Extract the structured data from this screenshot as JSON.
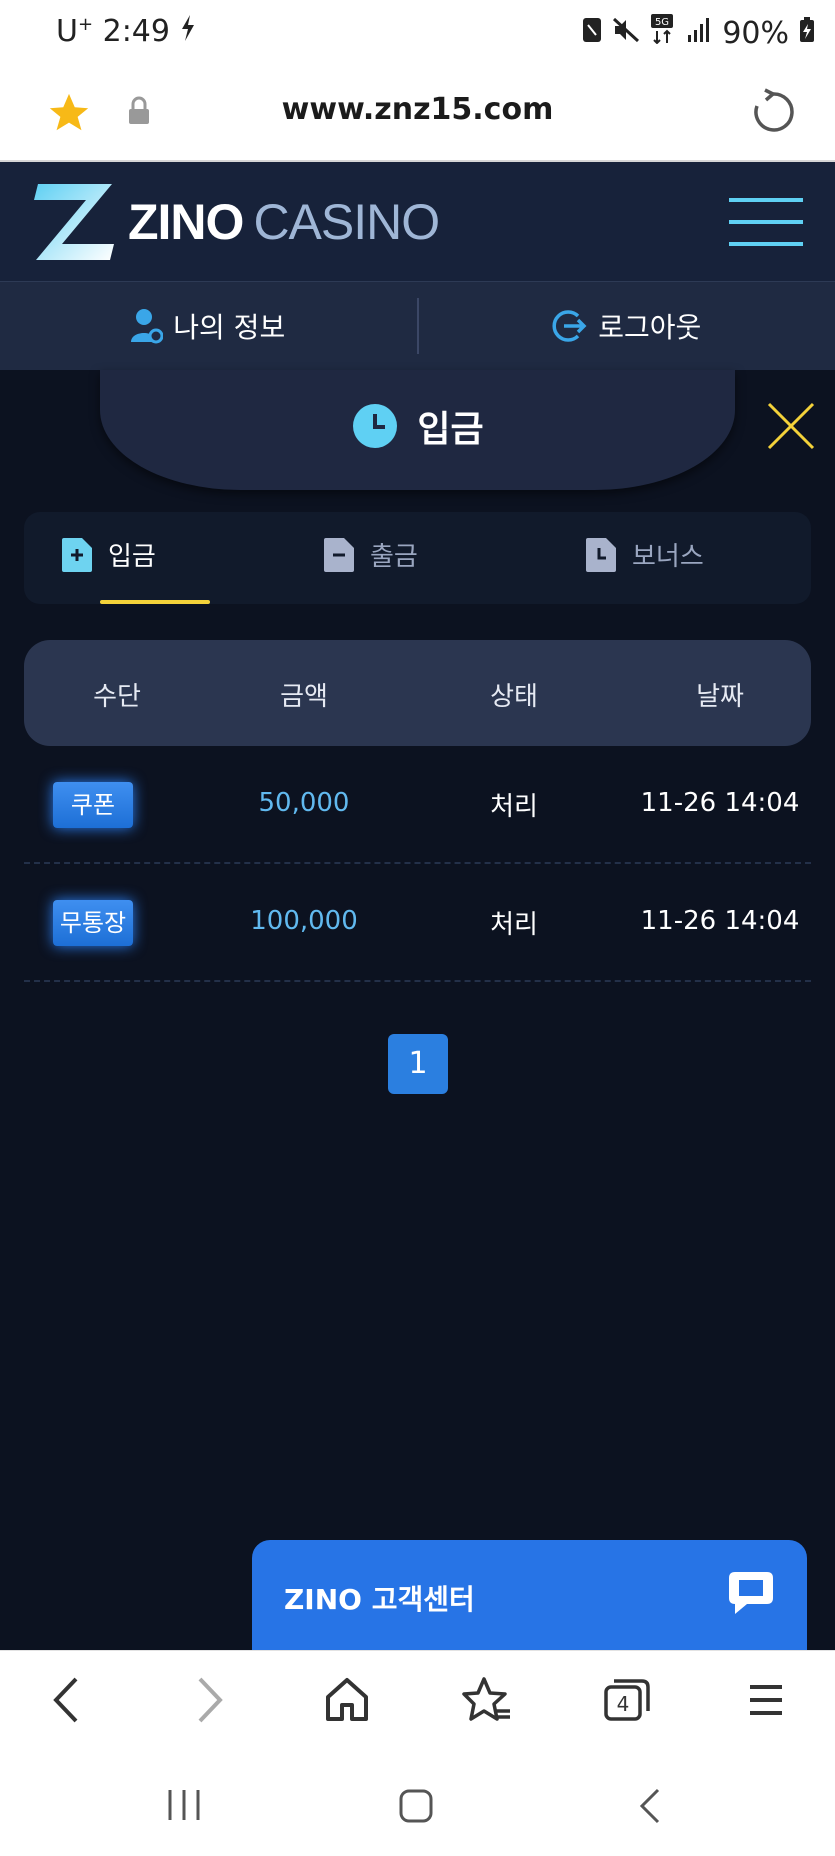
{
  "status_bar": {
    "carrier": "U",
    "carrier_sup": "+",
    "time": "2:49",
    "battery": "90%",
    "network": "5G"
  },
  "browser": {
    "url": "www.znz15.com",
    "tab_count": "4"
  },
  "site": {
    "logo_primary": "ZINO",
    "logo_secondary": "CASINO"
  },
  "account_bar": {
    "my_info": "나의 정보",
    "logout": "로그아웃"
  },
  "modal": {
    "title": "입금",
    "tabs": [
      {
        "label": "입금",
        "active": true
      },
      {
        "label": "출금",
        "active": false
      },
      {
        "label": "보너스",
        "active": false
      }
    ],
    "table": {
      "headers": [
        "수단",
        "금액",
        "상태",
        "날짜"
      ],
      "rows": [
        {
          "method": "쿠폰",
          "amount": "50,000",
          "status": "처리",
          "date": "11-26 14:04"
        },
        {
          "method": "무통장",
          "amount": "100,000",
          "status": "처리",
          "date": "11-26 14:04"
        }
      ]
    },
    "pagination": {
      "current": "1"
    }
  },
  "customer_center": {
    "label": "ZINO 고객센터"
  },
  "colors": {
    "accent_blue": "#2774e6",
    "amount_blue": "#61b9ef",
    "tab_underline": "#f4d23a",
    "background": "#0c1220"
  }
}
